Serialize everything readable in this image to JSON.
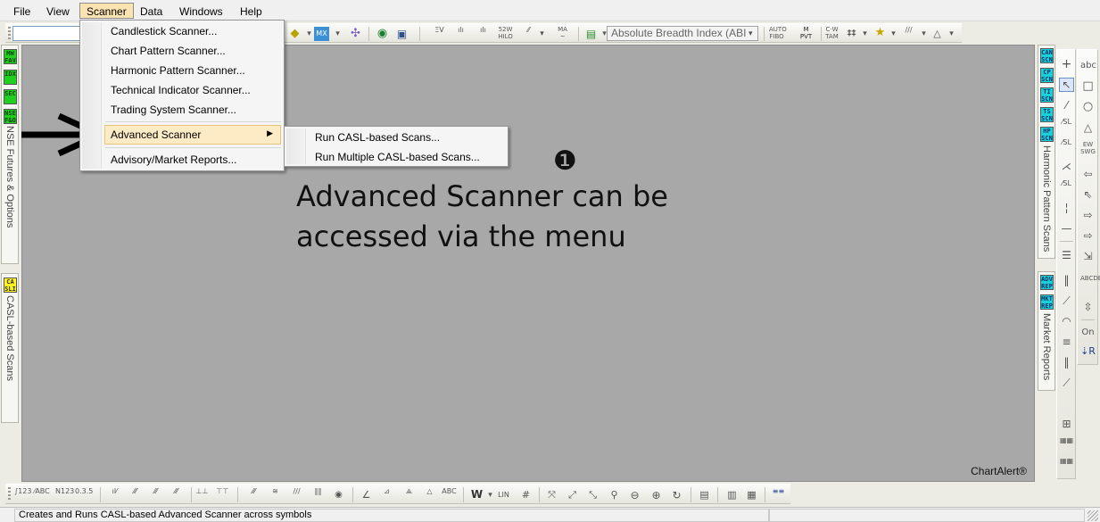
{
  "menubar": {
    "items": [
      "File",
      "View",
      "Scanner",
      "Data",
      "Windows",
      "Help"
    ],
    "active": "Scanner"
  },
  "toolbar": {
    "symbol_input_value": "",
    "indicator_select_value": "Absolute Breadth Index (ABI"
  },
  "scanner_menu": {
    "items": [
      "Candlestick Scanner...",
      "Chart Pattern Scanner...",
      "Harmonic Pattern Scanner...",
      "Technical Indicator Scanner...",
      "Trading System Scanner...",
      "Advanced Scanner",
      "Advisory/Market Reports..."
    ],
    "highlighted": "Advanced Scanner"
  },
  "advanced_submenu": {
    "items": [
      "Run CASL-based Scans...",
      "Run Multiple CASL-based Scans..."
    ]
  },
  "left_dock": {
    "badges_top": [
      "MW FAV",
      "IDX",
      "SEC",
      "NSE F&O"
    ],
    "tab_top_label": "NSE Futures & Options",
    "badges_bottom": [
      "CA SLI"
    ],
    "tab_bottom_label": "CASL-based Scans"
  },
  "right_dock": {
    "badges_top": [
      "CAN SCN",
      "CP SCN",
      "TI SCN",
      "TS SCN",
      "HP SCN"
    ],
    "tab_top_label": "Harmonic Pattern Scans",
    "badges_bottom": [
      "ADV REP",
      "MKT REP"
    ],
    "tab_bottom_label": "Market Reports"
  },
  "annotation": {
    "marker": "❶",
    "line1": "Advanced Scanner can be",
    "line2": "accessed via the menu"
  },
  "watermark": "ChartAlert®",
  "statusbar": {
    "text": "Creates and Runs CASL-based Advanced Scanner across symbols"
  }
}
